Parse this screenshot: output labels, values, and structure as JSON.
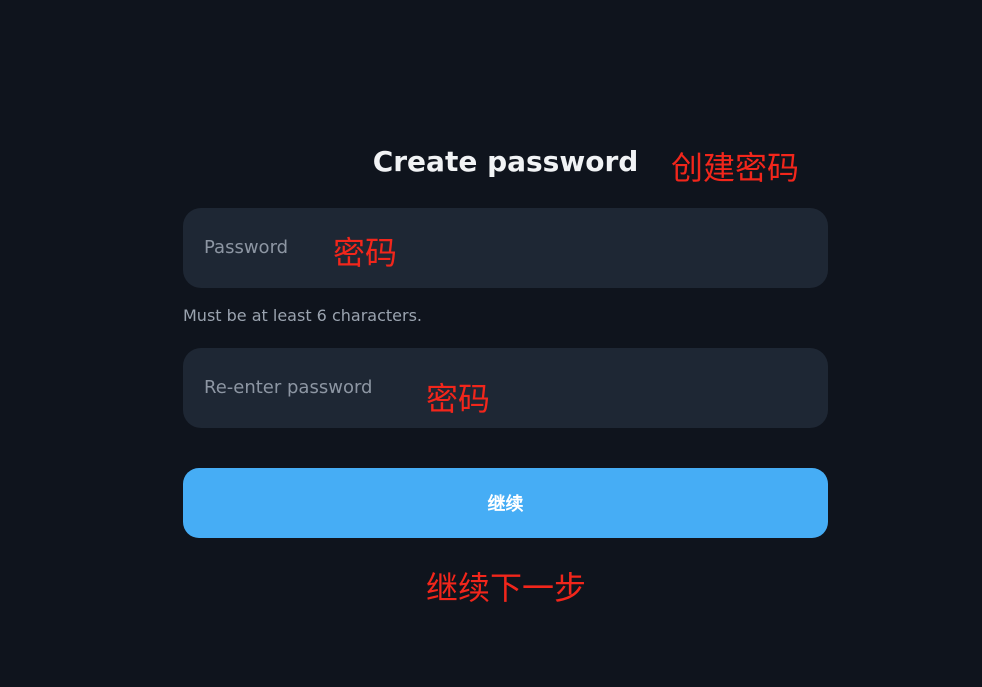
{
  "form": {
    "title": "Create password",
    "password_placeholder": "Password",
    "password_hint": "Must be at least 6 characters.",
    "reenter_placeholder": "Re-enter password",
    "continue_label": "继续"
  },
  "annotations": {
    "title_note": "创建密码",
    "password_note": "密码",
    "reenter_note": "密码",
    "continue_note": "继续下一步"
  },
  "colors": {
    "background": "#0f141d",
    "field_background": "#1e2734",
    "button_background": "#46adf5",
    "annotation_text": "#f2261b"
  }
}
